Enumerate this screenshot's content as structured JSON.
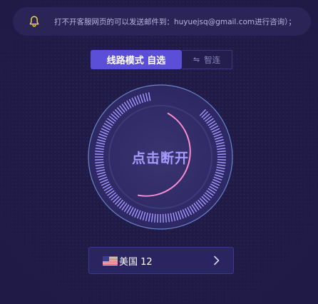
{
  "notice": {
    "text": "打不开客服网页的可以发送邮件到：huyuejsq@gmail.com进行咨询）；",
    "icon": "bell-icon",
    "icon_color": "#f2d44b"
  },
  "mode": {
    "active_label": "线路模式 自选",
    "inactive_label": "智连",
    "inactive_icon": "swap-icon"
  },
  "dial": {
    "label": "点击断开",
    "accent": "#a89aff",
    "arc_color": "#ff8fd2"
  },
  "region": {
    "flag": "us-flag-icon",
    "name": "美国 12",
    "chevron": "chevron-right-icon"
  }
}
